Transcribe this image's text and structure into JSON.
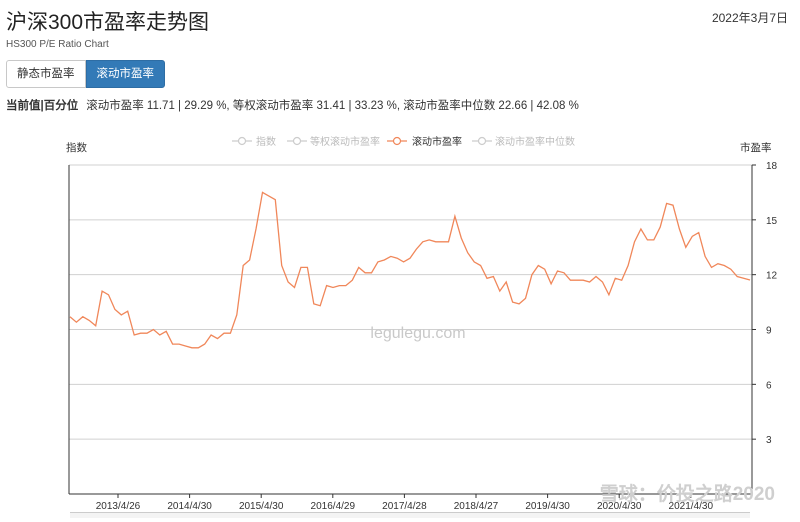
{
  "header": {
    "title": "沪深300市盈率走势图",
    "subtitle": "HS300 P/E Ratio Chart",
    "date": "2022年3月7日"
  },
  "tabs": [
    {
      "label": "静态市盈率",
      "active": false
    },
    {
      "label": "滚动市盈率",
      "active": true
    }
  ],
  "summary": {
    "label": "当前值|百分位",
    "text": "滚动市盈率 11.71 | 29.29 %, 等权滚动市盈率 31.41 | 33.23 %, 滚动市盈率中位数 22.66 | 42.08 %"
  },
  "watermark": {
    "center": "legulegu.com",
    "corner": "雪球：价投之路2020"
  },
  "colors": {
    "series": "#f0875a",
    "inactive_legend": "#cccccc",
    "axis": "#333333",
    "grid": "#d0d0d0"
  },
  "chart_data": {
    "type": "line",
    "title": "",
    "left_axis_label": "指数",
    "ylabel": "市盈率",
    "ylim": [
      0,
      18
    ],
    "yticks": [
      3,
      6,
      9,
      12,
      15,
      18
    ],
    "x_tick_labels": [
      "2013/4/26",
      "2014/4/30",
      "2015/4/30",
      "2016/4/29",
      "2017/4/28",
      "2018/4/27",
      "2019/4/30",
      "2020/4/30",
      "2021/4/30"
    ],
    "legend": [
      {
        "name": "指数",
        "active": false
      },
      {
        "name": "等权滚动市盈率",
        "active": false
      },
      {
        "name": "滚动市盈率",
        "active": true
      },
      {
        "name": "滚动市盈率中位数",
        "active": false
      }
    ],
    "legend_position": "top-center",
    "grid": true,
    "series": [
      {
        "name": "滚动市盈率",
        "values": [
          9.7,
          9.4,
          9.7,
          9.5,
          9.2,
          11.1,
          10.9,
          10.1,
          9.8,
          10.0,
          8.7,
          8.8,
          8.8,
          9.0,
          8.7,
          8.9,
          8.2,
          8.2,
          8.1,
          8.0,
          8.0,
          8.2,
          8.7,
          8.5,
          8.8,
          8.8,
          9.8,
          12.5,
          12.8,
          14.5,
          16.5,
          16.3,
          16.1,
          12.5,
          11.6,
          11.3,
          12.4,
          12.4,
          10.4,
          10.3,
          11.4,
          11.3,
          11.4,
          11.4,
          11.7,
          12.4,
          12.1,
          12.1,
          12.7,
          12.8,
          13.0,
          12.9,
          12.7,
          12.9,
          13.4,
          13.8,
          13.9,
          13.8,
          13.8,
          13.8,
          15.2,
          14.0,
          13.2,
          12.7,
          12.5,
          11.8,
          11.9,
          11.1,
          11.6,
          10.5,
          10.4,
          10.7,
          12.0,
          12.5,
          12.3,
          11.5,
          12.2,
          12.1,
          11.7,
          11.7,
          11.7,
          11.6,
          11.9,
          11.6,
          10.9,
          11.8,
          11.7,
          12.5,
          13.8,
          14.5,
          13.9,
          13.9,
          14.6,
          15.9,
          15.8,
          14.5,
          13.5,
          14.1,
          14.3,
          13.0,
          12.4,
          12.6,
          12.5,
          12.3,
          11.9,
          11.8,
          11.71
        ]
      }
    ]
  }
}
